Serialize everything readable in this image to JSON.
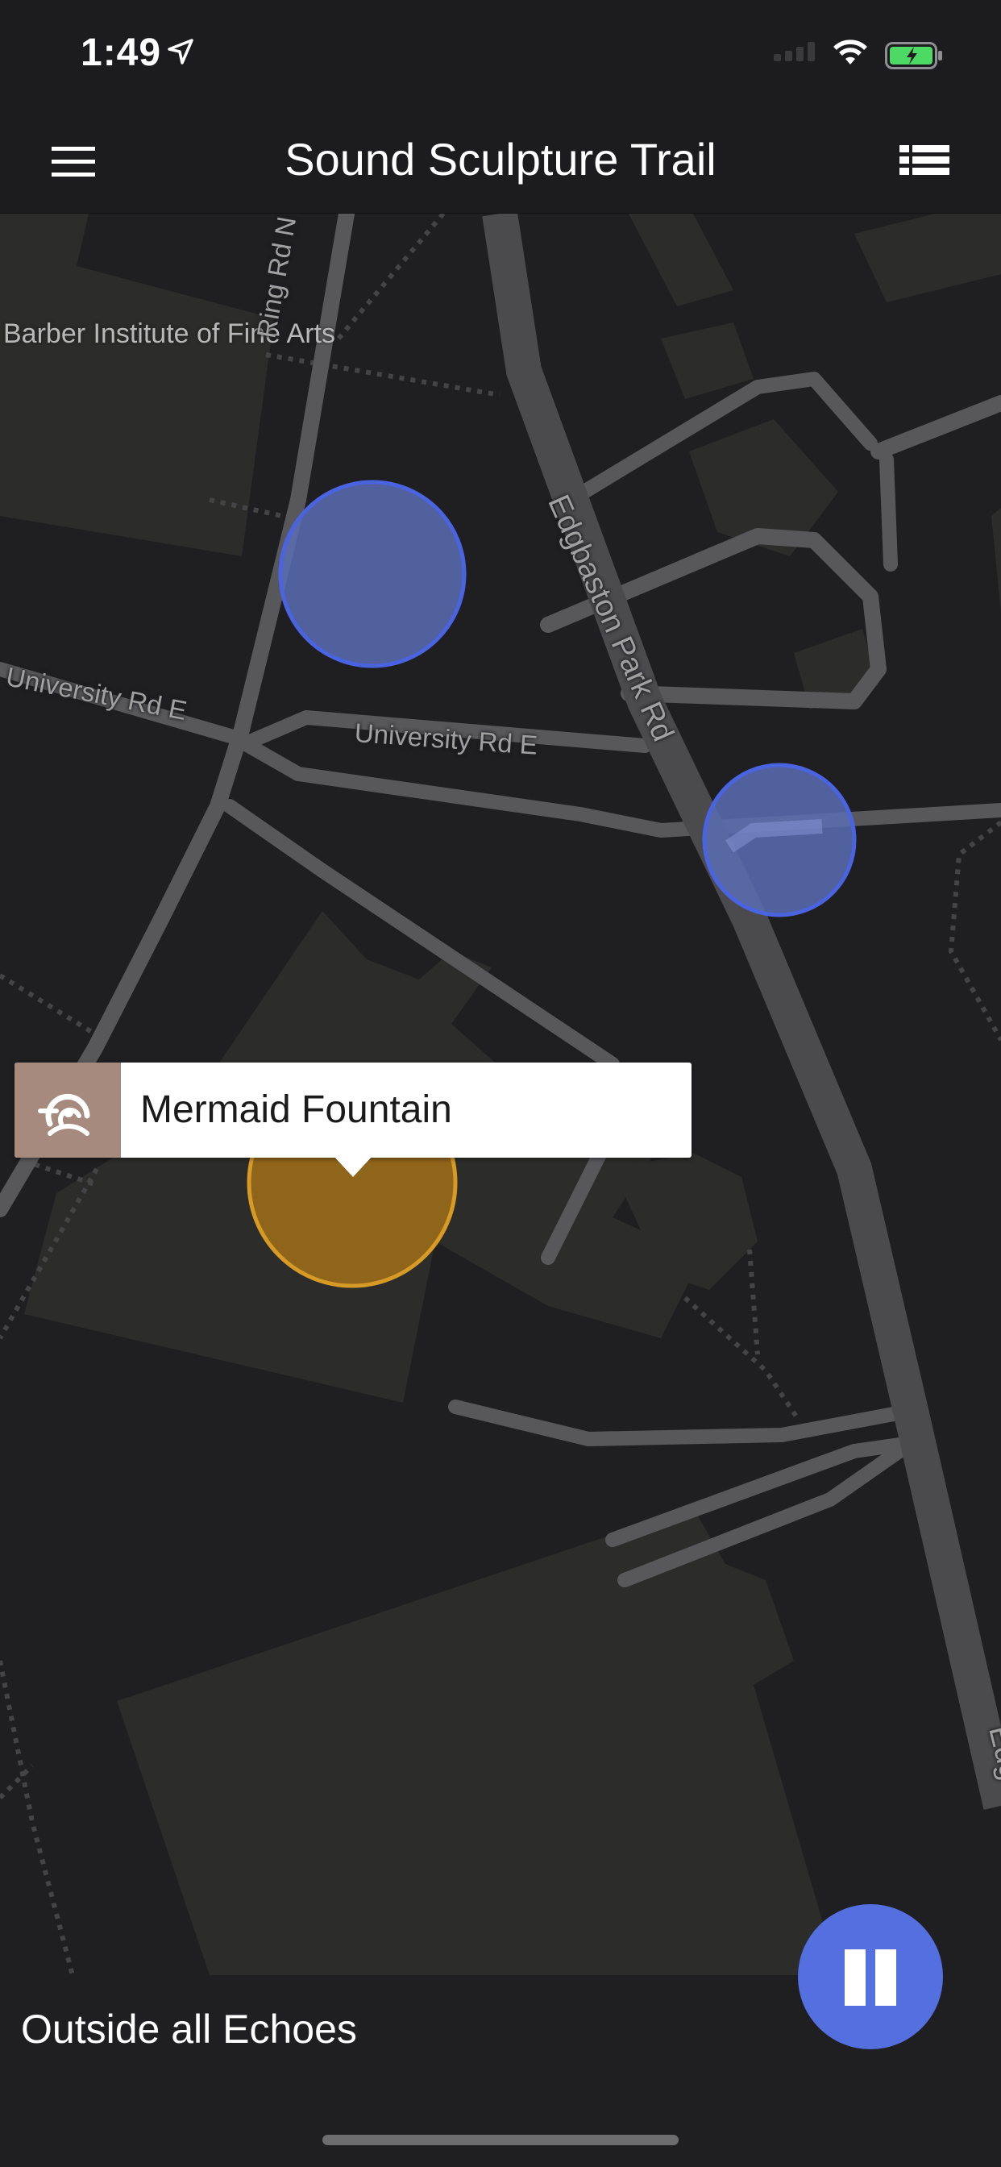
{
  "status_bar": {
    "time": "1:49"
  },
  "nav": {
    "title": "Sound Sculpture Trail"
  },
  "map": {
    "labels": {
      "poi": "Barber Institute of Fine Arts",
      "ring_rd": "Ring Rd N",
      "university_rd_1": "University Rd E",
      "university_rd_2": "University Rd E",
      "edgbaston_rd": "Edgbaston Park Rd",
      "edgbaston_partial": "Edg"
    }
  },
  "callout": {
    "title": "Mermaid Fountain"
  },
  "footer": {
    "status": "Outside all Echoes"
  },
  "colors": {
    "zone_blue": "#5470e0",
    "zone_active": "#c68a1a",
    "callout_icon_bg": "#a58a7d",
    "map_bg": "#1f1f21"
  },
  "icons": [
    "location-arrow-icon",
    "wifi-icon",
    "battery-icon",
    "hamburger-menu-icon",
    "list-icon",
    "echo-icon",
    "pause-icon"
  ]
}
